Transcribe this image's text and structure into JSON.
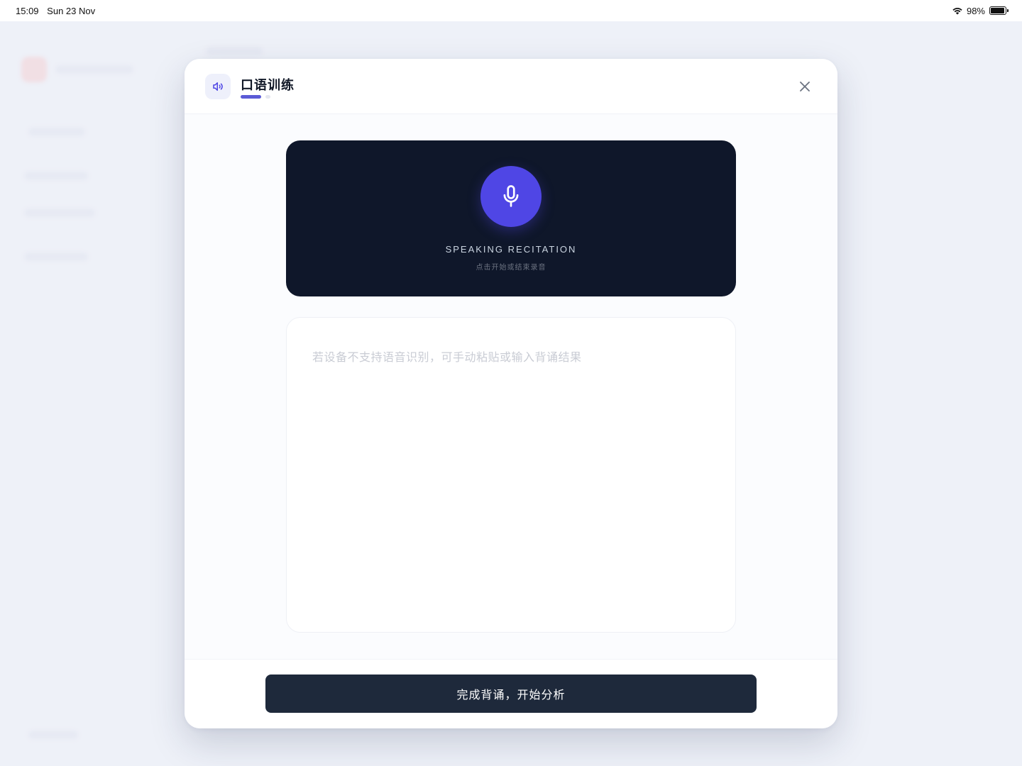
{
  "status_bar": {
    "time": "15:09",
    "date": "Sun 23 Nov",
    "battery": "98%",
    "battery_level": 0.98
  },
  "modal": {
    "title": "口语训练",
    "steps": {
      "current": 1,
      "total": 2
    },
    "recorder": {
      "title": "SPEAKING RECITATION",
      "subtitle": "点击开始或结束录音"
    },
    "textarea": {
      "value": "",
      "placeholder": "若设备不支持语音识别，可手动粘贴或输入背诵结果"
    },
    "submit_label": "完成背诵，开始分析"
  },
  "colors": {
    "accent": "#4f46e5",
    "recorder_bg": "#0f172a",
    "button_bg": "#1e293b"
  },
  "icons": {
    "header": "speaker-icon",
    "close": "close-icon",
    "record": "microphone-icon"
  }
}
